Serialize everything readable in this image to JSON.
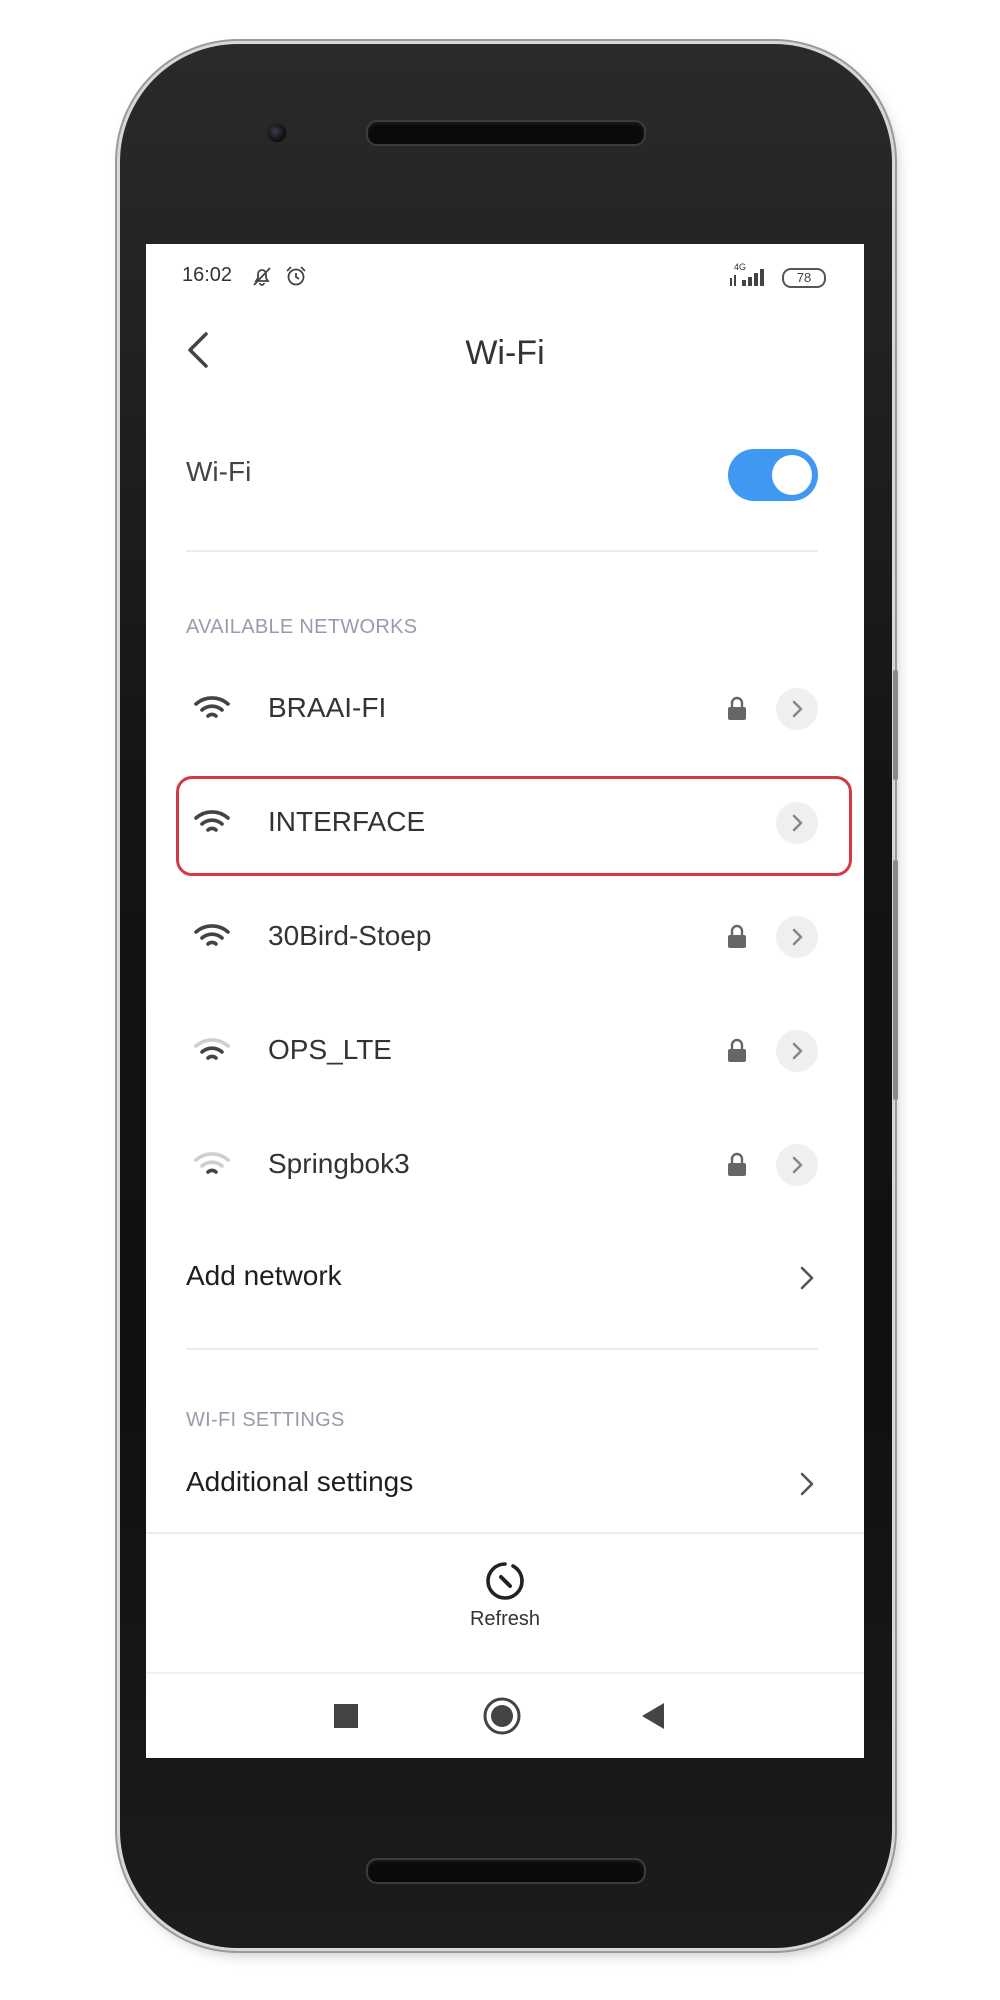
{
  "status_bar": {
    "time": "16:02",
    "network_type": "4G",
    "battery": "78",
    "icons": [
      "bell-off-icon",
      "alarm-icon",
      "signal-icon",
      "battery-icon"
    ]
  },
  "header": {
    "title": "Wi-Fi",
    "back_icon": "chevron-left-icon"
  },
  "wifi_toggle": {
    "label": "Wi-Fi",
    "state": "on",
    "accent_color": "#3f98f2"
  },
  "available_networks": {
    "section_label": "AVAILABLE NETWORKS",
    "items": [
      {
        "name": "BRAAI-FI",
        "secured": true,
        "signal": "full"
      },
      {
        "name": "INTERFACE",
        "secured": false,
        "signal": "full",
        "highlighted": true
      },
      {
        "name": "30Bird-Stoep",
        "secured": true,
        "signal": "full"
      },
      {
        "name": "OPS_LTE",
        "secured": true,
        "signal": "medium"
      },
      {
        "name": "Springbok3",
        "secured": true,
        "signal": "weak"
      }
    ],
    "add_network_label": "Add network"
  },
  "wifi_settings": {
    "section_label": "WI-FI SETTINGS",
    "additional_settings_label": "Additional settings"
  },
  "bottom_action": {
    "refresh_label": "Refresh",
    "refresh_icon": "refresh-icon"
  },
  "nav_bar": {
    "icons": [
      "recent-apps-icon",
      "home-icon",
      "back-triangle-icon"
    ]
  },
  "highlight_color": "#d43a44"
}
